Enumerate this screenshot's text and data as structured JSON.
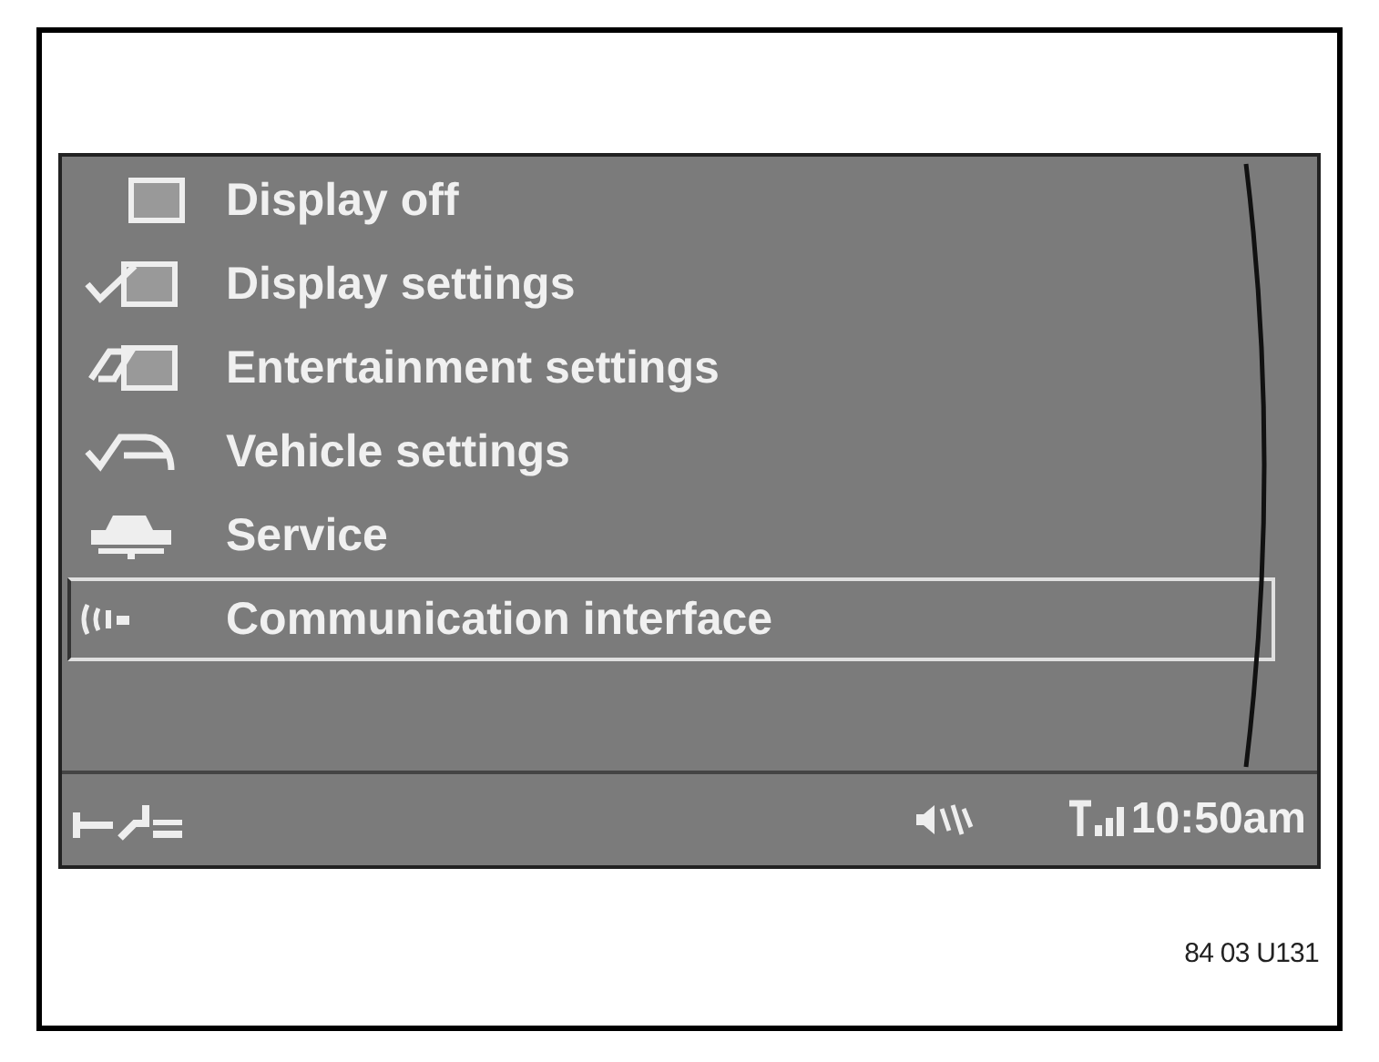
{
  "menu": {
    "items": [
      {
        "label": "Display off",
        "selected": false
      },
      {
        "label": "Display settings",
        "selected": false
      },
      {
        "label": "Entertainment settings",
        "selected": false
      },
      {
        "label": "Vehicle settings",
        "selected": false
      },
      {
        "label": "Service",
        "selected": false
      },
      {
        "label": "Communication interface",
        "selected": true
      }
    ]
  },
  "status_bar": {
    "time": "10:50am"
  },
  "figure_code": "84 03 U131"
}
